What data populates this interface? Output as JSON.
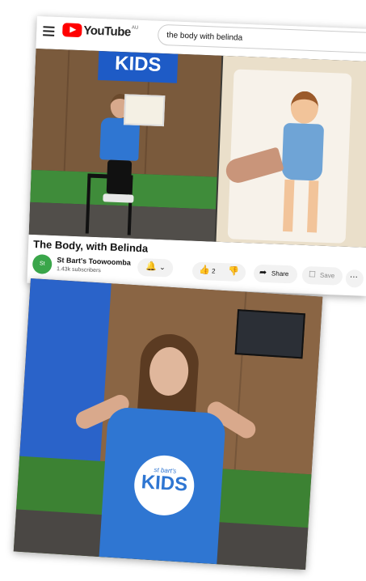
{
  "youtube": {
    "logo_text": "YouTube",
    "region": "AU",
    "search_query": "the body with belinda",
    "video_title": "The Body, with Belinda",
    "channel": {
      "avatar_text": "St Bart's",
      "name": "St Bart's Toowoomba",
      "subscribers": "1.43k subscribers"
    },
    "actions": {
      "likes": "2",
      "share_label": "Share",
      "save_label": "Save"
    },
    "video_overlay": {
      "screen_text": "KIDS"
    }
  },
  "still": {
    "shirt_label_small": "st bart's",
    "shirt_label_big": "KIDS"
  },
  "colors": {
    "youtube_red": "#ff0000",
    "shirt_blue": "#2f76d2",
    "avatar_green": "#3aa64a"
  }
}
